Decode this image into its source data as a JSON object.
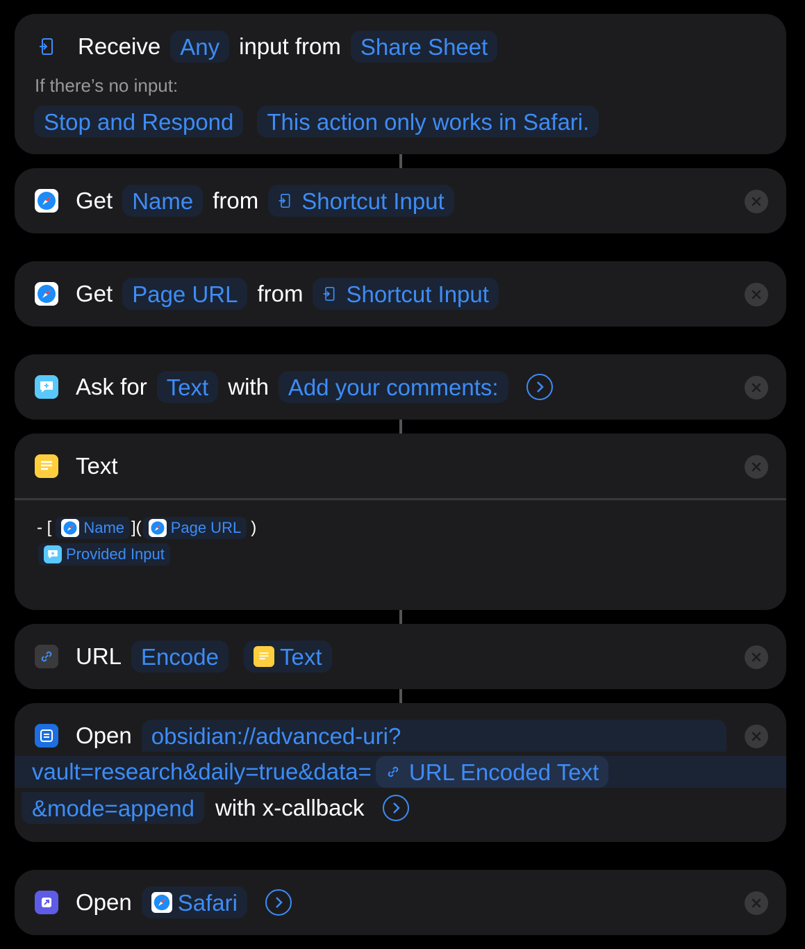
{
  "colors": {
    "accent": "#3e8cf6",
    "card_bg": "#1c1c1e",
    "token_bg": "#1a2434",
    "background": "#000000"
  },
  "receive": {
    "word_receive": "Receive",
    "type_token": "Any",
    "word_input_from": "input from",
    "source_token": "Share Sheet",
    "no_input_label": "If there’s no input:",
    "fallback_token": "Stop and Respond",
    "message_token": "This action only works in Safari."
  },
  "get_name": {
    "verb": "Get",
    "property": "Name",
    "word_from": "from",
    "source": "Shortcut Input"
  },
  "get_url": {
    "verb": "Get",
    "property": "Page URL",
    "word_from": "from",
    "source": "Shortcut Input"
  },
  "ask": {
    "verb": "Ask for",
    "type": "Text",
    "word_with": "with",
    "prompt": "Add your comments:"
  },
  "text_action": {
    "title": "Text",
    "prefix": "- [",
    "name_var": "Name",
    "mid": "](",
    "url_var": "Page URL",
    "suffix": ")",
    "provided_var": "Provided Input"
  },
  "url_encode": {
    "verb": "URL",
    "mode": "Encode",
    "input": "Text"
  },
  "open_url": {
    "verb": "Open",
    "url_part1": "obsidian://advanced-uri?",
    "url_part2": "vault=research&daily=true&data=",
    "var": "URL Encoded Text",
    "url_part3": "&mode=append",
    "callback_label": "with x-callback"
  },
  "open_app": {
    "verb": "Open",
    "app": "Safari"
  },
  "icons": [
    "share-sheet-icon",
    "safari-icon",
    "ask-icon",
    "text-icon",
    "link-icon",
    "open-url-icon",
    "open-app-icon",
    "close-icon",
    "chevron-right-icon"
  ]
}
